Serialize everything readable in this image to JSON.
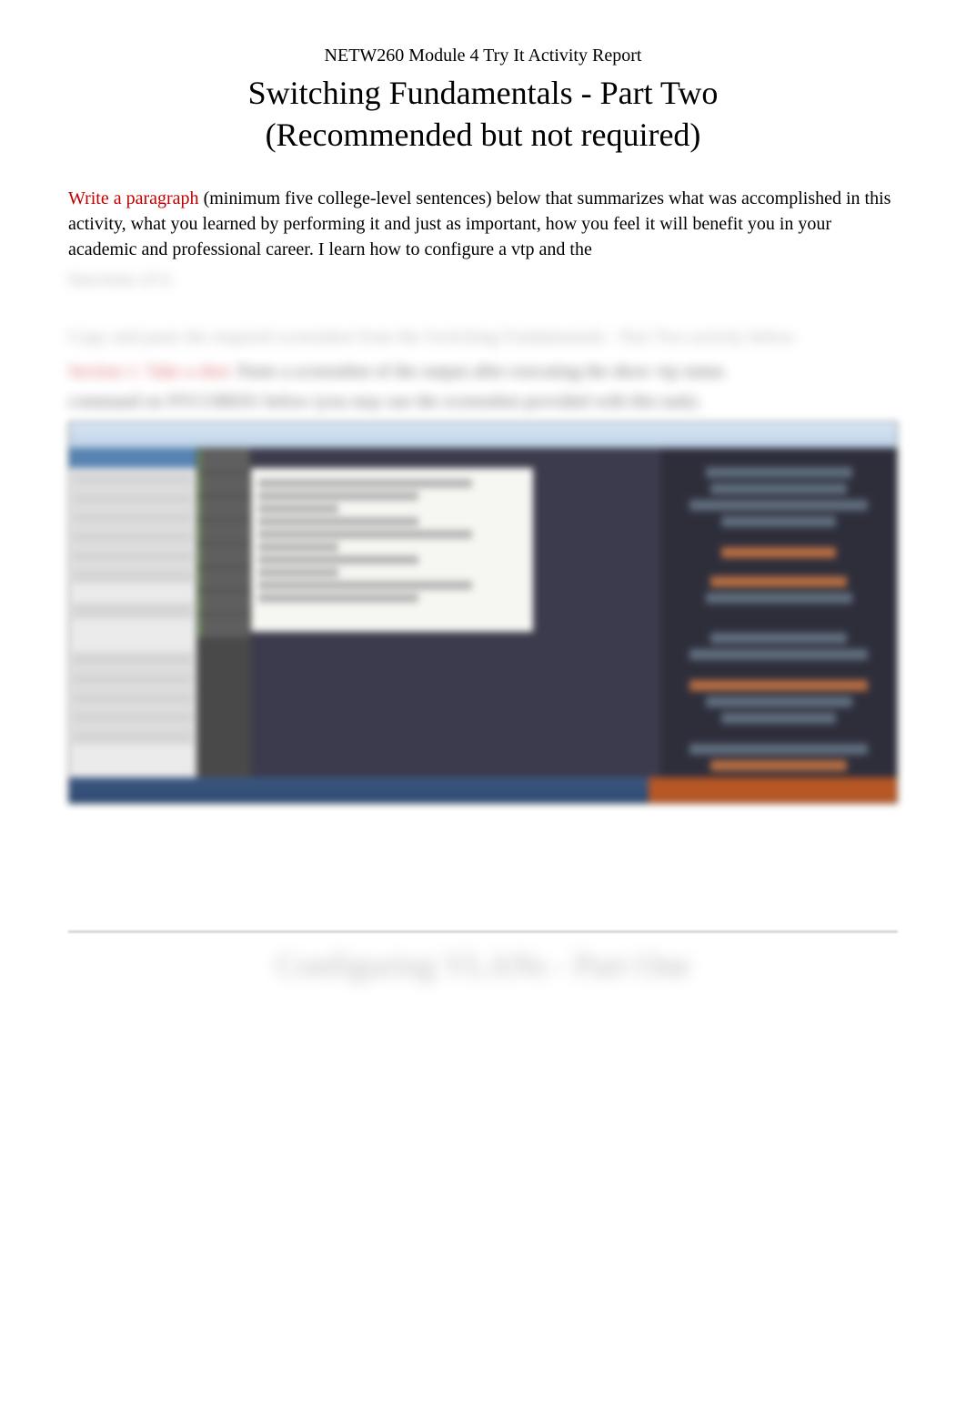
{
  "header": {
    "course_line": "NETW260 Module 4 Try It Activity Report",
    "title": "Switching Fundamentals - Part Two",
    "subtitle": "(Recommended but not required)"
  },
  "instructions": {
    "prompt_label": "Write a paragraph",
    "prompt_body": " (minimum five college-level sentences) below that summarizes what was accomplished in this activity, what you learned by performing it and just as important, how you feel it will benefit you in your academic and professional career. I learn how to configure a vtp and the",
    "blurred_tail": "functions of it."
  },
  "blurred": {
    "copy_paste_line": "Copy and paste the required screenshot from the   Switching Fundamentals - Part Two   activity below.",
    "section_prefix": "Section 1:",
    "section_red": "Take a shot:",
    "section_body": "Paste a screenshot of the output after executing the   show vtp status",
    "section_body2": "command on NYCORE01 below (you may use the screenshot provided with this task)."
  },
  "next_section": {
    "heading": "Configuring VLANs - Part One"
  }
}
